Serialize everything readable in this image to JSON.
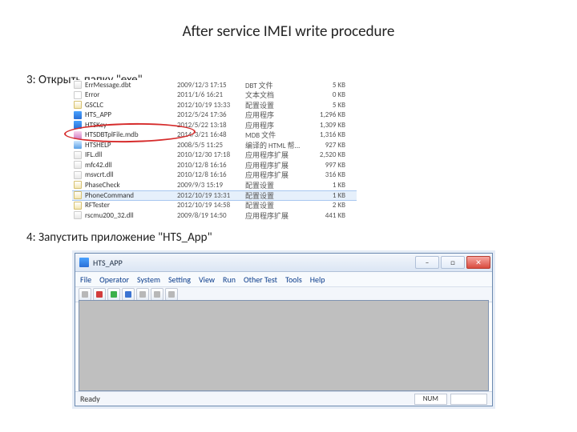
{
  "title": "After service IMEI write procedure",
  "step3": "3: Открыть папку \"exe\".",
  "step4": "4: Запустить приложение \"HTS_App\"",
  "files": [
    {
      "icon": "dll",
      "name": "ErrMessage.dbt",
      "date": "2009/12/3 17:15",
      "type": "DBT 文件",
      "size": "5 KB"
    },
    {
      "icon": "dbt",
      "name": "Error",
      "date": "2011/1/6 16:21",
      "type": "文本文档",
      "size": "0 KB"
    },
    {
      "icon": "ini",
      "name": "GSCLC",
      "date": "2012/10/19 13:33",
      "type": "配置设置",
      "size": "5 KB"
    },
    {
      "icon": "exe",
      "name": "HTS_APP",
      "date": "2012/5/24 17:36",
      "type": "应用程序",
      "size": "1,296 KB",
      "hl": true
    },
    {
      "icon": "exe",
      "name": "HTSKey",
      "date": "2012/5/22 13:18",
      "type": "应用程序",
      "size": "1,309 KB"
    },
    {
      "icon": "mdb",
      "name": "HTSDBTplFile.mdb",
      "date": "2014/3/21 16:48",
      "type": "MDB 文件",
      "size": "1,316 KB"
    },
    {
      "icon": "chm",
      "name": "HTSHELP",
      "date": "2008/5/5 11:25",
      "type": "编译的 HTML 帮...",
      "size": "927 KB"
    },
    {
      "icon": "dll",
      "name": "IFL.dll",
      "date": "2010/12/30 17:18",
      "type": "应用程序扩展",
      "size": "2,520 KB"
    },
    {
      "icon": "dll",
      "name": "mfc42.dll",
      "date": "2010/12/8 16:16",
      "type": "应用程序扩展",
      "size": "997 KB"
    },
    {
      "icon": "dll",
      "name": "msvcrt.dll",
      "date": "2010/12/8 16:16",
      "type": "应用程序扩展",
      "size": "316 KB"
    },
    {
      "icon": "ini",
      "name": "PhaseCheck",
      "date": "2009/9/3 15:19",
      "type": "配置设置",
      "size": "1 KB"
    },
    {
      "icon": "ini",
      "name": "PhoneCommand",
      "date": "2012/10/19 13:31",
      "type": "配置设置",
      "size": "1 KB",
      "sel": true
    },
    {
      "icon": "ini",
      "name": "RFTester",
      "date": "2012/10/19 14:58",
      "type": "配置设置",
      "size": "2 KB"
    },
    {
      "icon": "dll",
      "name": "rscmu200_32.dll",
      "date": "2009/8/19 14:50",
      "type": "应用程序扩展",
      "size": "441 KB"
    }
  ],
  "app": {
    "title": "HTS_APP",
    "menu": [
      "File",
      "Operator",
      "System",
      "Setting",
      "View",
      "Run",
      "Other Test",
      "Tools",
      "Help"
    ],
    "status_left": "Ready",
    "status_right": "NUM",
    "winbtns": {
      "min": "–",
      "max": "□",
      "close": "✕"
    }
  }
}
